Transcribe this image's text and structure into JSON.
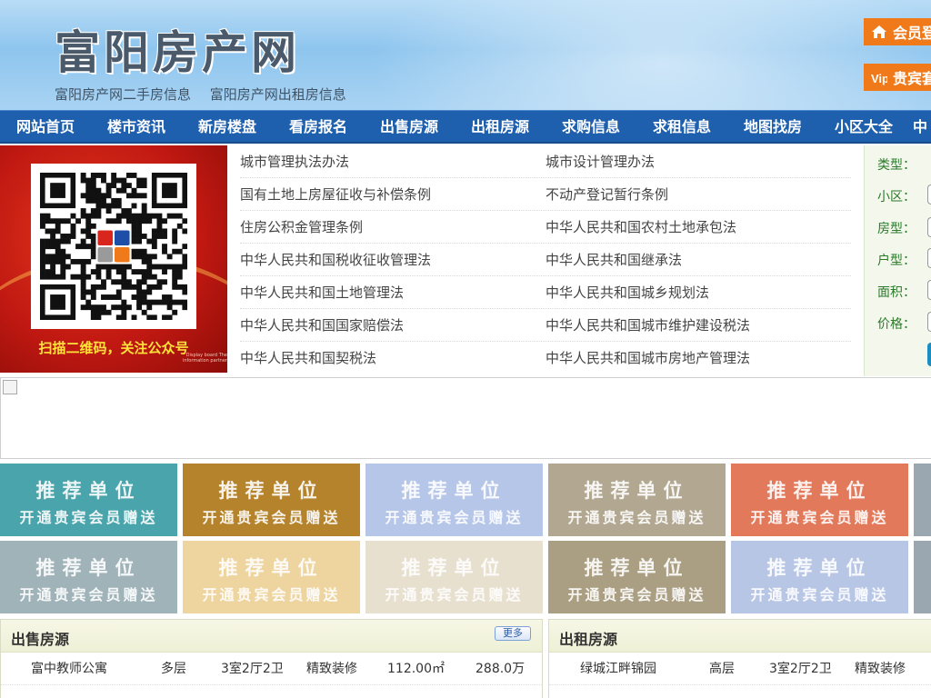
{
  "header": {
    "site_title": "富阳房产网",
    "sublinks": [
      "富阳房产网二手房信息",
      "富阳房产网出租房信息"
    ],
    "login_label": "会员登",
    "vip_label": "贵宾套",
    "vip_icon_text": "Vip",
    "accent": "#f07a1a"
  },
  "nav": {
    "items": [
      "网站首页",
      "楼市资讯",
      "新房楼盘",
      "看房报名",
      "出售房源",
      "出租房源",
      "求购信息",
      "求租信息",
      "地图找房",
      "小区大全",
      "中"
    ],
    "background": "#1e5fae"
  },
  "qr": {
    "caption": "扫描二维码，关注公众号",
    "tiny_text": "Display board  The information partner",
    "icon": "qr-code-icon"
  },
  "laws": {
    "rows": [
      [
        "城市管理执法办法",
        "城市设计管理办法"
      ],
      [
        "国有土地上房屋征收与补偿条例",
        "不动产登记暂行条例"
      ],
      [
        "住房公积金管理条例",
        "中华人民共和国农村土地承包法"
      ],
      [
        "中华人民共和国税收征收管理法",
        "中华人民共和国继承法"
      ],
      [
        "中华人民共和国土地管理法",
        "中华人民共和国城乡规划法"
      ],
      [
        "中华人民共和国国家赔偿法",
        "中华人民共和国城市维护建设税法"
      ],
      [
        "中华人民共和国契税法",
        "中华人民共和国城市房地产管理法"
      ]
    ]
  },
  "search": {
    "labels": [
      "类型：",
      "小区：",
      "房型：",
      "户型：",
      "面积：",
      "价格："
    ]
  },
  "tiles": {
    "line1": "推荐单位",
    "line2": "开通贵宾会员赠送",
    "row1_colors": [
      "#4aa4ab",
      "#b5832b",
      "#b6c6e8",
      "#b2a891",
      "#e2795a",
      "#9aa6b0"
    ],
    "row2_colors": [
      "#9fb3b9",
      "#eed49e",
      "#e8e0cf",
      "#ab9f83",
      "#b8c6e6",
      "#9aa6b0"
    ]
  },
  "sale": {
    "title": "出售房源",
    "more": "更多",
    "rows": [
      {
        "name": "富中教师公寓",
        "type": "多层",
        "layout": "3室2厅2卫",
        "decor": "精致装修",
        "area": "112.00㎡",
        "price": "288.0万"
      }
    ]
  },
  "rent": {
    "title": "出租房源",
    "rows": [
      {
        "name": "绿城江畔锦园",
        "type": "高层",
        "layout": "3室2厅2卫",
        "decor": "精致装修"
      }
    ]
  }
}
